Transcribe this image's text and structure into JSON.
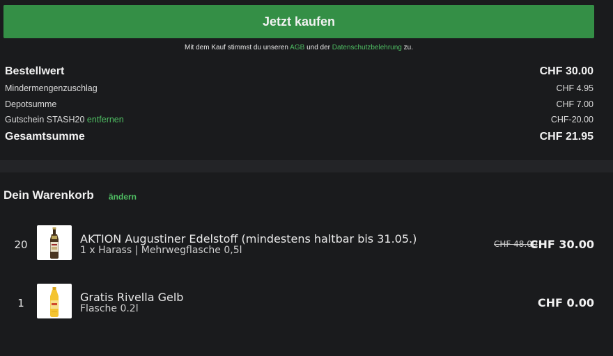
{
  "checkout": {
    "buy_label": "Jetzt kaufen",
    "consent_pre": "Mit dem Kauf stimmst du unseren ",
    "consent_agb": "AGB",
    "consent_mid": " und der ",
    "consent_privacy": "Datenschutzbelehrung",
    "consent_post": " zu."
  },
  "summary": {
    "order_value_label": "Bestellwert",
    "order_value": "CHF 30.00",
    "min_qty_label": "Mindermengenzuschlag",
    "min_qty": "CHF 4.95",
    "deposit_label": "Depotsumme",
    "deposit": "CHF 7.00",
    "voucher_label": "Gutschein STASH20",
    "voucher_remove": "entfernen",
    "voucher": "CHF-20.00",
    "total_label": "Gesamtsumme",
    "total": "CHF 21.95"
  },
  "cart": {
    "title": "Dein Warenkorb",
    "edit_label": "ändern",
    "items": [
      {
        "qty": "20",
        "name": "AKTION Augustiner Edelstoff (mindestens haltbar bis 31.05.)",
        "sub": "1 x Harass | Mehrwegflasche 0,5l",
        "old_price": "CHF 48.00",
        "price": "CHF 30.00",
        "icon": "beer-bottle-icon"
      },
      {
        "qty": "1",
        "name": "Gratis Rivella Gelb",
        "sub": "Flasche 0.2l",
        "price": "CHF 0.00",
        "icon": "soda-bottle-icon"
      }
    ]
  },
  "colors": {
    "accent": "#348f46",
    "link": "#4fbf63",
    "background": "#1a1b1d"
  }
}
